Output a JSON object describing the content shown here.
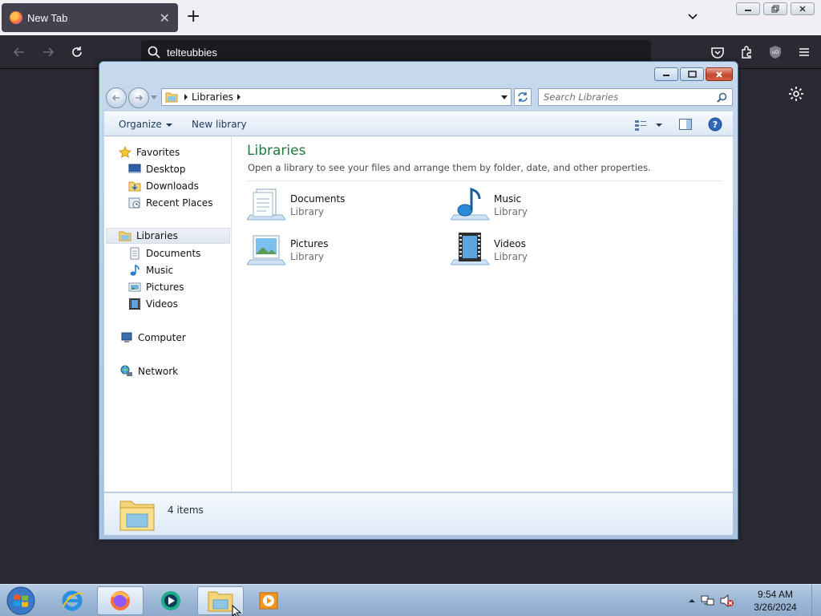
{
  "browser": {
    "tab_title": "New Tab",
    "url_text": "telteubbies"
  },
  "explorer": {
    "breadcrumb": "Libraries",
    "search_placeholder": "Search Libraries",
    "toolbar": {
      "organize_label": "Organize",
      "new_library_label": "New library"
    },
    "nav": {
      "favorites": "Favorites",
      "favorites_items": [
        "Desktop",
        "Downloads",
        "Recent Places"
      ],
      "libraries": "Libraries",
      "libraries_items": [
        "Documents",
        "Music",
        "Pictures",
        "Videos"
      ],
      "computer": "Computer",
      "network": "Network"
    },
    "content": {
      "title": "Libraries",
      "subtitle": "Open a library to see your files and arrange them by folder, date, and other properties.",
      "libraries": [
        {
          "name": "Documents",
          "type": "Library",
          "icon": "documents-library-icon"
        },
        {
          "name": "Music",
          "type": "Library",
          "icon": "music-library-icon"
        },
        {
          "name": "Pictures",
          "type": "Library",
          "icon": "pictures-library-icon"
        },
        {
          "name": "Videos",
          "type": "Library",
          "icon": "videos-library-icon"
        }
      ]
    },
    "details": {
      "item_count": "4 items"
    }
  },
  "taskbar": {
    "time": "9:54 AM",
    "date": "3/26/2024"
  },
  "colors": {
    "accent_green": "#1e7a3a",
    "browser_dark": "#2b2a33"
  }
}
